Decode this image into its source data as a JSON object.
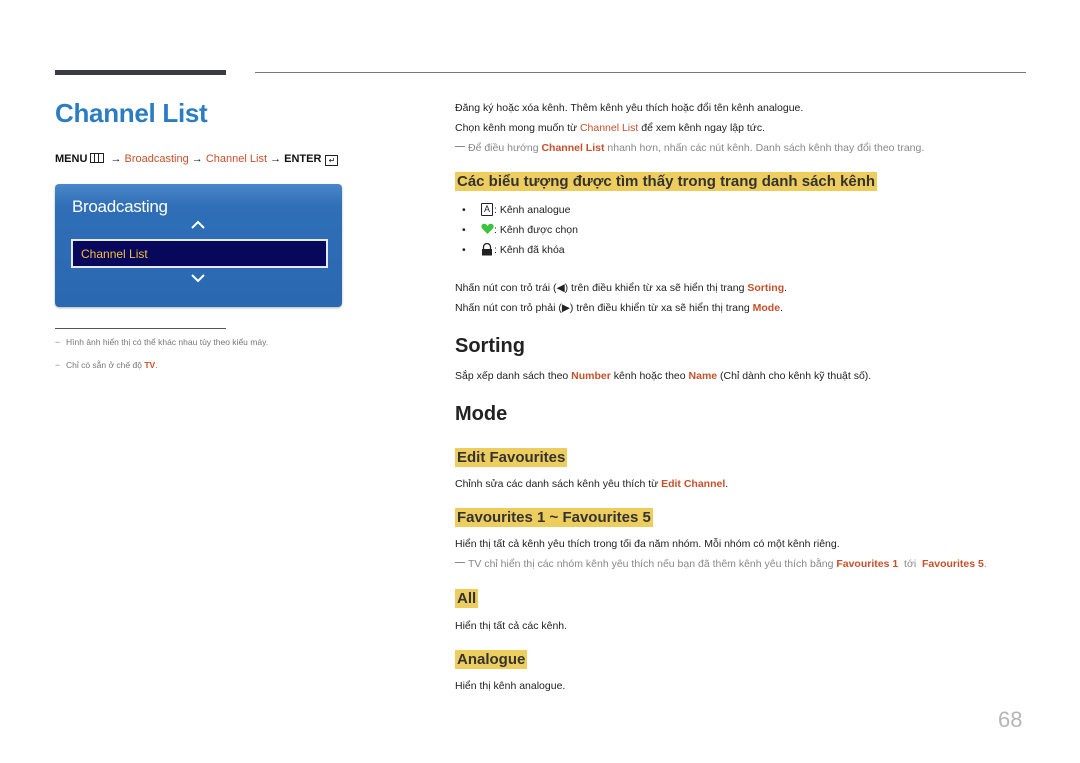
{
  "header": {
    "title": "Channel List"
  },
  "menu_path": {
    "menu": "MENU",
    "arrow": "→",
    "broadcasting": "Broadcasting",
    "channel_list": "Channel List",
    "enter": "ENTER",
    "menu_icon": "menu-grid-icon",
    "enter_icon": "enter-icon"
  },
  "osd": {
    "title": "Broadcasting",
    "selected_item": "Channel List",
    "up_icon": "chevron-up-icon",
    "down_icon": "chevron-down-icon",
    "colors": {
      "panel": "#2a68b2",
      "selected_bg": "#07075c",
      "selected_text": "#f0c040"
    }
  },
  "notes": [
    {
      "dash": "−",
      "text": "Hình ảnh hiển thị có thể khác nhau tùy theo kiểu máy."
    },
    {
      "dash": "−",
      "text_before": "Chỉ có sẵn ở chế độ ",
      "highlight": "TV",
      "text_after": "."
    }
  ],
  "intro": {
    "line1": "Đăng ký hoặc xóa kênh. Thêm kênh yêu thích hoặc đổi tên kênh analogue.",
    "line2_before": "Chọn kênh mong muốn từ ",
    "line2_link": "Channel List",
    "line2_after": " để xem kênh ngay lập tức.",
    "note_before": "Để điều hướng ",
    "note_link": "Channel List",
    "note_after": " nhanh hơn, nhấn các nút kênh. Danh sách kênh thay đổi theo trang."
  },
  "icons_section": {
    "heading": "Các biểu tượng được tìm thấy trong trang danh sách kênh",
    "items": [
      {
        "icon": "analogue-a-icon",
        "glyph": "A",
        "label": ": Kênh analogue"
      },
      {
        "icon": "heart-icon",
        "label": ": Kênh được chọn"
      },
      {
        "icon": "lock-icon",
        "label": ": Kênh đã khóa"
      }
    ],
    "nav1_before": "Nhấn nút con trỏ trái (",
    "nav1_glyph": "◀",
    "nav1_middle": ") trên điều khiển từ xa sẽ hiển thị trang ",
    "nav1_link": "Sorting",
    "nav1_after": ".",
    "nav2_before": "Nhấn nút con trỏ phải (",
    "nav2_glyph": "▶",
    "nav2_middle": ") trên điều khiển từ xa sẽ hiển thị trang ",
    "nav2_link": "Mode",
    "nav2_after": "."
  },
  "sorting": {
    "heading": "Sorting",
    "text_before": "Sắp xếp danh sách theo ",
    "link1": "Number",
    "text_middle": " kênh hoặc theo ",
    "link2": "Name",
    "text_after": " (Chỉ dành cho kênh kỹ thuật số)."
  },
  "mode": {
    "heading": "Mode",
    "edit_favourites": {
      "heading": "Edit Favourites",
      "text_before": "Chỉnh sửa các danh sách kênh yêu thích từ ",
      "link": "Edit Channel",
      "text_after": "."
    },
    "favourites": {
      "heading": "Favourites 1 ~ Favourites 5",
      "text": "Hiển thị tất cả kênh yêu thích trong tối đa năm nhóm. Mỗi nhóm có một kênh riêng.",
      "note_before": "TV chỉ hiển thị các nhóm kênh yêu thích nếu bạn đã thêm kênh yêu thích bằng ",
      "note_link1": "Favourites 1",
      "note_middle": "  tới  ",
      "note_link2": "Favourites 5",
      "note_after": "."
    },
    "all": {
      "heading": "All",
      "text": "Hiển thị tất cả các kênh."
    },
    "analogue": {
      "heading": "Analogue",
      "text": "Hiển thị kênh analogue."
    }
  },
  "page_number": "68",
  "colors": {
    "title_blue": "#2a7dc4",
    "link_orange": "#c8502a",
    "highlight_yellow": "#eecd5f",
    "heart_green": "#3cc43c"
  }
}
